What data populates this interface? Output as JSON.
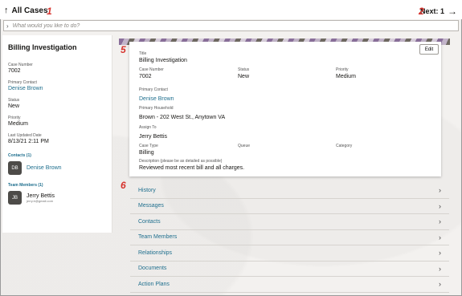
{
  "header": {
    "back_label": "All Cases",
    "next_label": "Next: 1"
  },
  "search": {
    "placeholder": "What would you like to do?"
  },
  "callouts": [
    "1",
    "2",
    "3",
    "4",
    "5",
    "6"
  ],
  "left_panel": {
    "title": "Billing Investigation",
    "fields": [
      {
        "label": "Case Number",
        "value": "7002"
      },
      {
        "label": "Primary Contact",
        "value": "Denise Brown"
      },
      {
        "label": "Status",
        "value": "New"
      },
      {
        "label": "Priority",
        "value": "Medium"
      },
      {
        "label": "Last Updated Date",
        "value": "8/13/21 2:11 PM"
      }
    ],
    "contacts_title": "Contacts (1)",
    "contact": {
      "initials": "DB",
      "name": "Denise Brown"
    },
    "team_title": "Team Members (1)",
    "team_member": {
      "initials": "JB",
      "name": "Jerry Bettis",
      "email": "jerry.b@gmail.com"
    }
  },
  "card": {
    "edit_label": "Edit",
    "title_label": "Title",
    "title_value": "Billing Investigation",
    "case_number_label": "Case Number",
    "case_number_value": "7002",
    "status_label": "Status",
    "status_value": "New",
    "priority_label": "Priority",
    "priority_value": "Medium",
    "primary_contact_label": "Primary Contact",
    "primary_contact_value": "Denise Brown",
    "household_label": "Primary Household",
    "household_value": "Brown - 202 West St., Anytown VA",
    "assign_label": "Assign To",
    "assign_value": "Jerry Bettis",
    "case_type_label": "Case Type",
    "case_type_value": "Billing",
    "queue_label": "Queue",
    "category_label": "Category",
    "description_label": "Description (please be as detailed as possible)",
    "description_value": "Reviewed most recent bill and all charges."
  },
  "accordion": [
    "History",
    "Messages",
    "Contacts",
    "Team Members",
    "Relationships",
    "Documents",
    "Action Plans"
  ],
  "colors": {
    "accent": "#1f6f8e",
    "callout": "#d6312b"
  }
}
